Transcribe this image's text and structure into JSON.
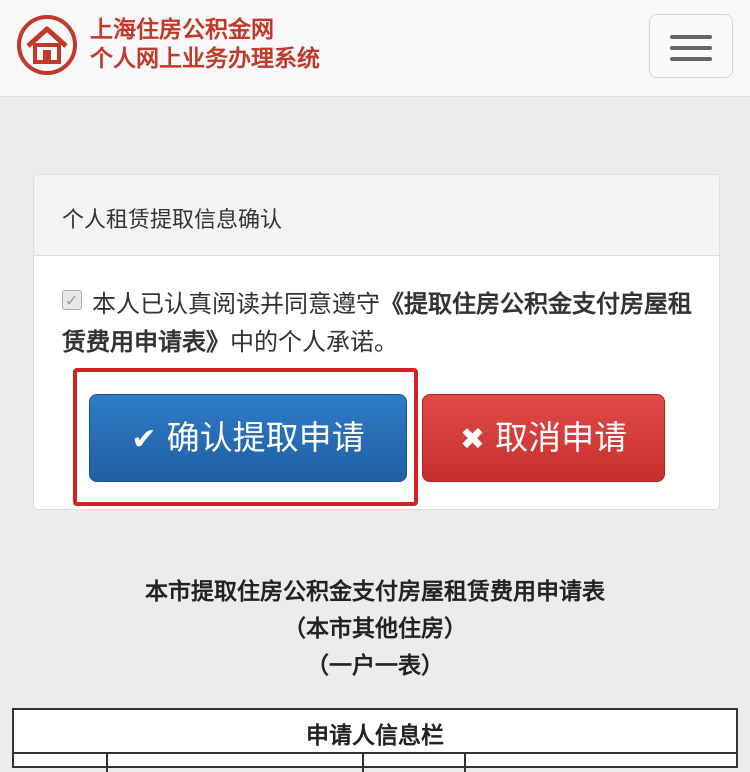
{
  "header": {
    "site_name": "上海住房公积金网",
    "system_name": "个人网上业务办理系统",
    "brand_color": "#c0392b"
  },
  "panel": {
    "title": "个人租赁提取信息确认",
    "agree_prefix": "本人已认真阅读并同意遵守",
    "agree_doc": "《提取住房公积金支付房屋租赁费用申请表》",
    "agree_suffix": "中的个人承诺。",
    "checkbox_checked": true
  },
  "buttons": {
    "confirm_icon": "✔",
    "confirm_label": "确认提取申请",
    "cancel_icon": "✖",
    "cancel_label": "取消申请",
    "confirm_color": "#2568b0",
    "cancel_color": "#d23b38"
  },
  "form": {
    "title": "本市提取住房公积金支付房屋租赁费用申请表",
    "subtitle1": "（本市其他住房）",
    "subtitle2": "（一户一表）",
    "table_header": "申请人信息栏"
  }
}
